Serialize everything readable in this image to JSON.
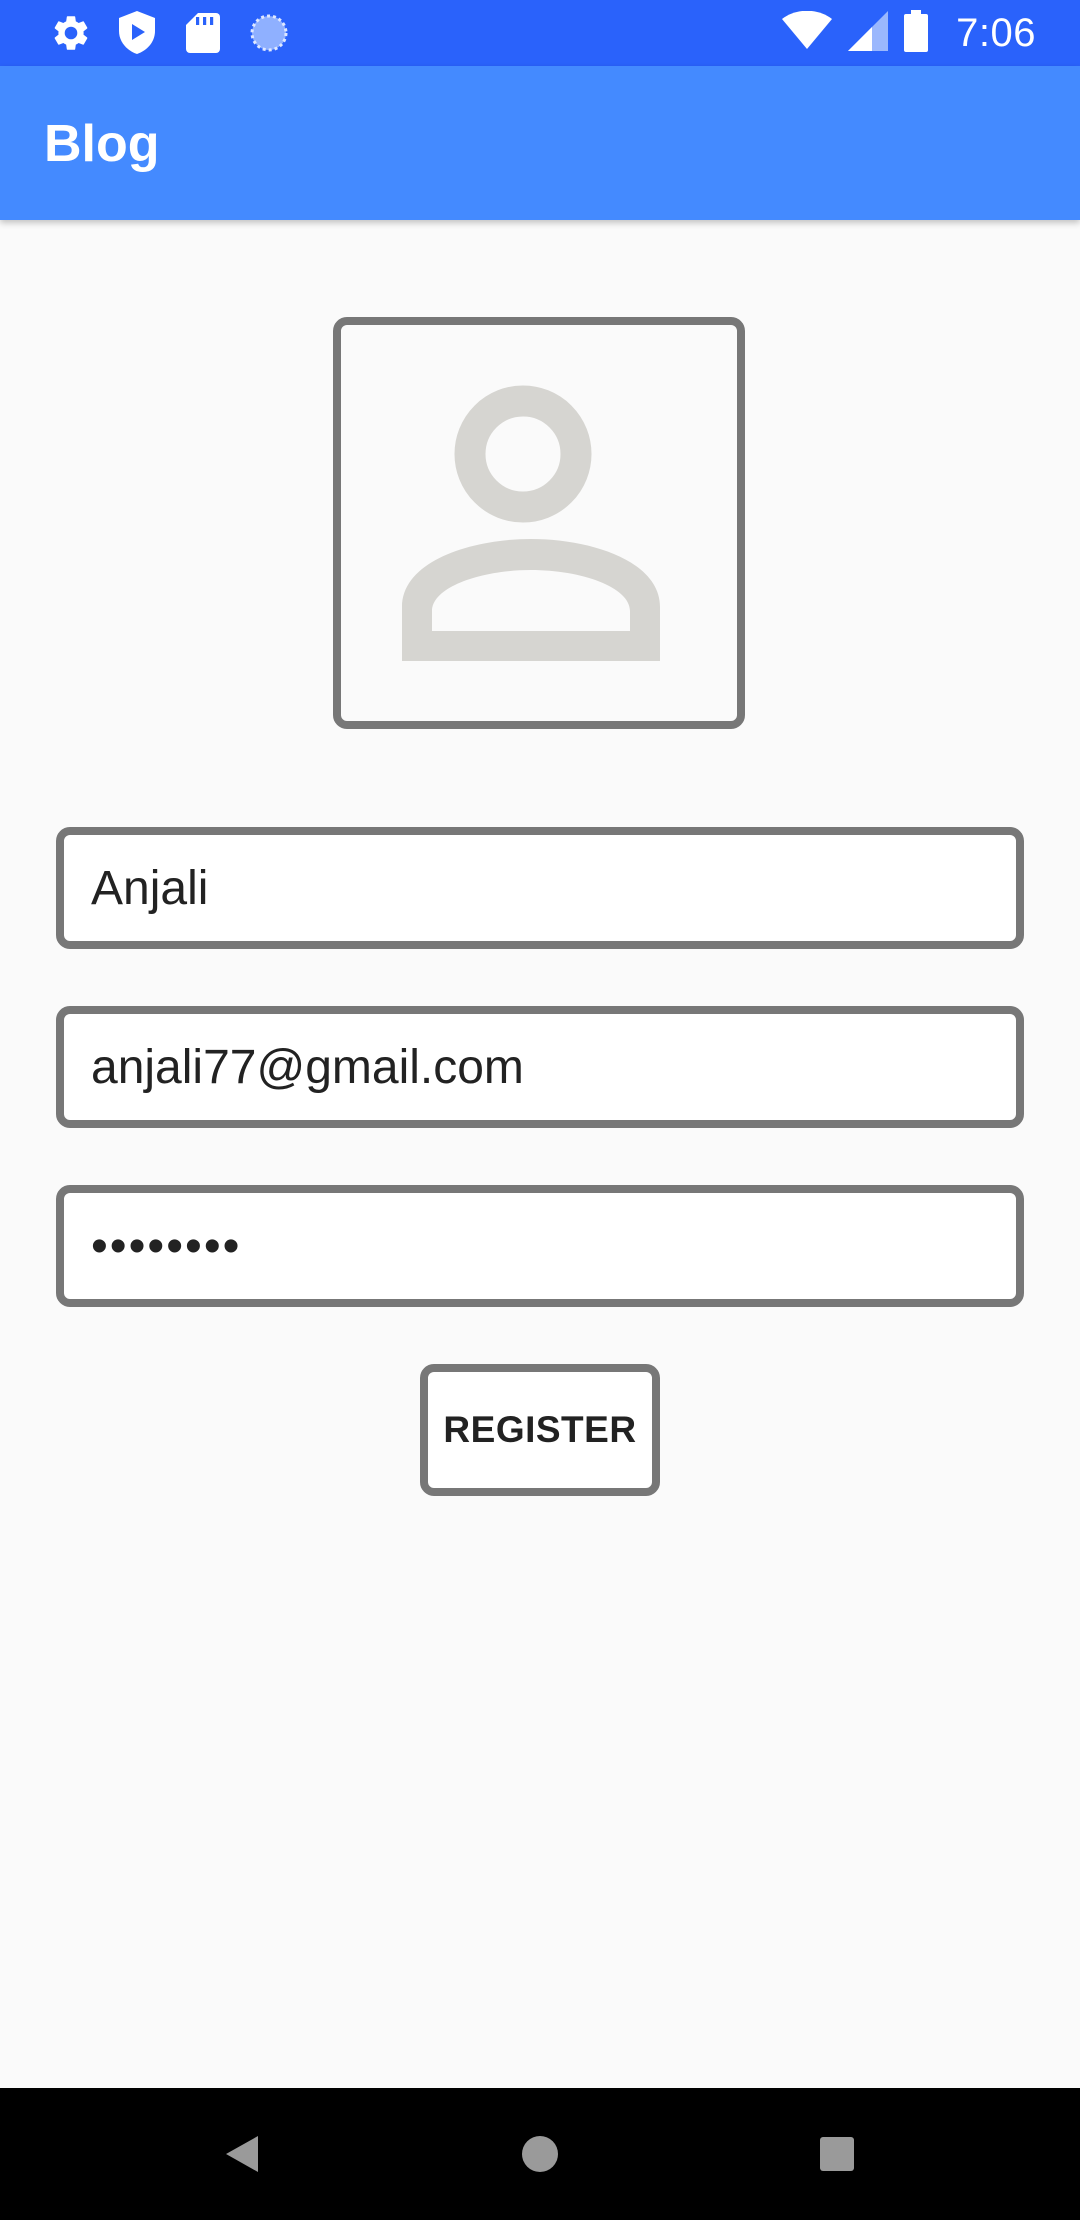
{
  "status_bar": {
    "time": "7:06",
    "left_icons": [
      "settings-icon",
      "shield-play-icon",
      "sd-card-icon",
      "sync-circle-icon"
    ],
    "right_icons": [
      "wifi-icon",
      "cell-signal-icon",
      "battery-icon"
    ]
  },
  "app_bar": {
    "title": "Blog"
  },
  "avatar": {
    "icon": "person-icon"
  },
  "form": {
    "name_value": "Anjali",
    "email_value": "anjali77@gmail.com",
    "password_value": "••••••••",
    "register_label": "REGISTER"
  },
  "nav_bar": {
    "icons": [
      "back-icon",
      "home-icon",
      "recents-icon"
    ]
  },
  "colors": {
    "status_bar": "#2a62fb",
    "app_bar": "#448aff",
    "background": "#fafafa",
    "border": "#777777",
    "avatar_icon": "#d6d5d1"
  }
}
